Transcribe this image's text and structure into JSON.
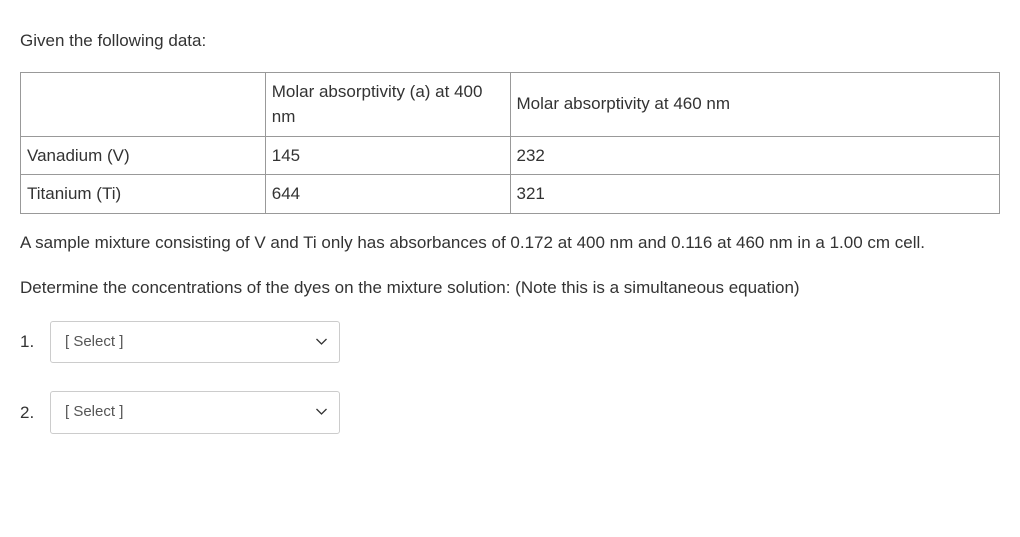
{
  "intro": "Given the following data:",
  "table": {
    "header": {
      "c1": "",
      "c2": "Molar absorptivity (a) at 400 nm",
      "c3": "Molar absorptivity at 460 nm"
    },
    "rows": [
      {
        "c1": "Vanadium (V)",
        "c2": "145",
        "c3": "232"
      },
      {
        "c1": "Titanium (Ti)",
        "c2": "644",
        "c3": "321"
      }
    ]
  },
  "para1": "A sample mixture consisting of V and Ti only has absorbances of 0.172 at 400 nm and 0.116 at 460 nm in a 1.00 cm cell.",
  "para2": "Determine the concentrations of the dyes on the mixture solution: (Note this is a simultaneous equation)",
  "select_placeholder": "[ Select ]"
}
